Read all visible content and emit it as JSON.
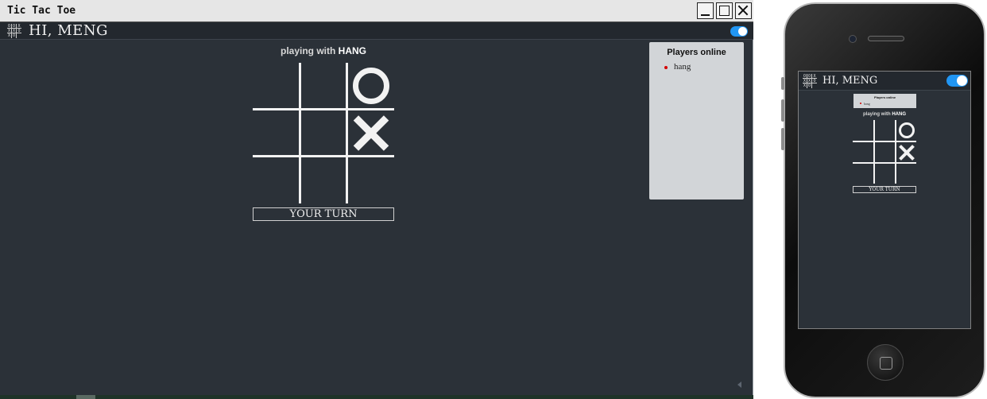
{
  "window": {
    "title": "Tic Tac Toe"
  },
  "header": {
    "greeting": "HI, MENG",
    "logo_cells": [
      "O",
      "O",
      "X",
      "X",
      "X",
      "O",
      "X",
      "O",
      ""
    ]
  },
  "game": {
    "playing_prefix": "playing with",
    "opponent": "HANG",
    "board": [
      "",
      "",
      "O",
      "",
      "",
      "X",
      "",
      "",
      ""
    ],
    "status": "YOUR TURN"
  },
  "players": {
    "title": "Players online",
    "list": [
      "hang"
    ]
  },
  "colors": {
    "background": "#2b3138",
    "toggle_on": "#2196f3",
    "online_dot": "#d40000",
    "panel": "#d2d5d8"
  },
  "icons": {
    "logo": "tic-tac-toe-logo-icon",
    "toggle": "toggle-switch-icon",
    "online": "online-dot-icon",
    "home": "home-button-icon"
  }
}
